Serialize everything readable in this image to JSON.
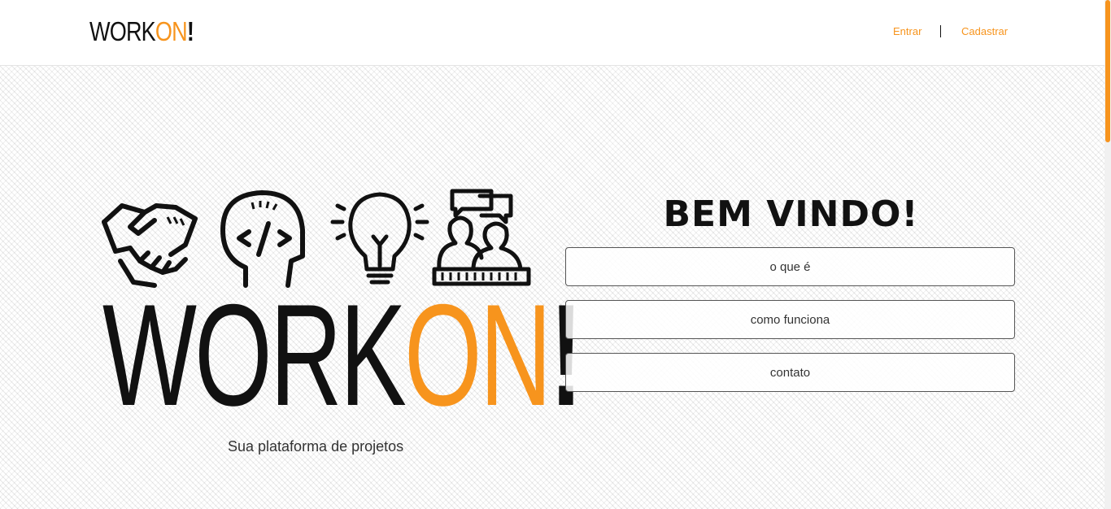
{
  "header": {
    "logo_work": "WORK",
    "logo_on": "ON",
    "logo_excl": "!",
    "nav_entrar": "Entrar",
    "nav_cadastrar": "Cadastrar"
  },
  "hero": {
    "logo_work": "WORK",
    "logo_on": "ON",
    "logo_excl": "!",
    "tagline": "Sua plataforma de projetos",
    "icons": [
      "handshake-icon",
      "coding-head-icon",
      "lightbulb-icon",
      "team-chat-icon"
    ]
  },
  "welcome": {
    "title": "BEM VINDO!",
    "buttons": [
      "o que é",
      "como funciona",
      "contato"
    ]
  },
  "colors": {
    "accent": "#f7941d",
    "text": "#111111"
  }
}
